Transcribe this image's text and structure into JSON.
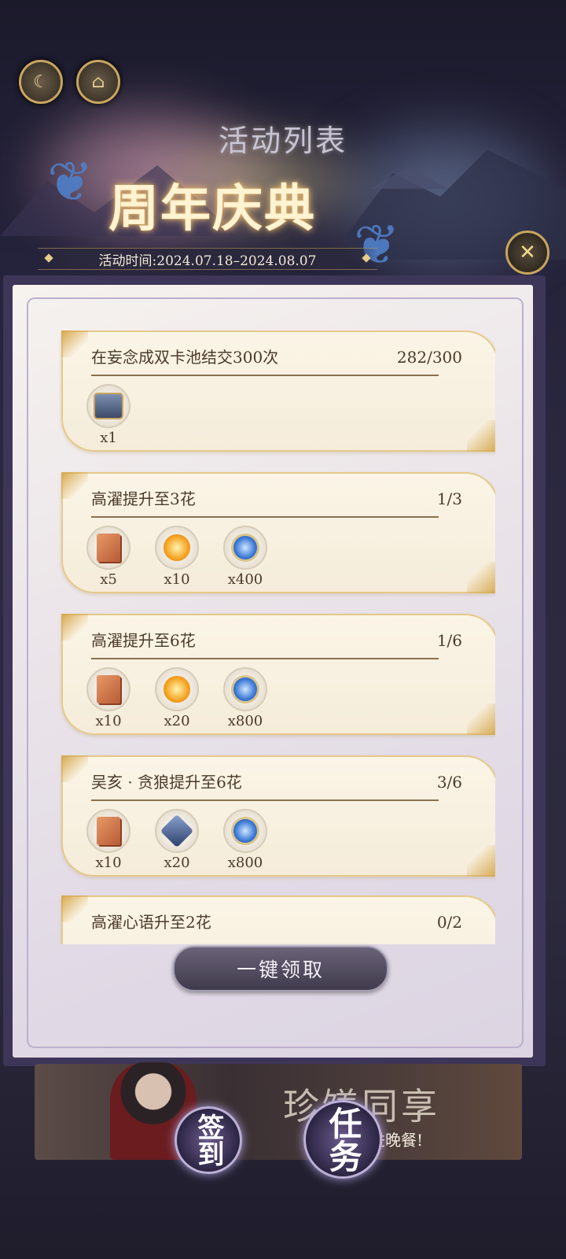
{
  "header": {
    "subtitle": "活动列表",
    "title": "周年庆典",
    "period": "活动时间:2024.07.18–2024.08.07"
  },
  "tasks": [
    {
      "title": "在妄念成双卡池结交300次",
      "progress": "282/300",
      "rewards": [
        {
          "icon": "treasure-chest-icon",
          "qty": "x1"
        }
      ]
    },
    {
      "title": "高濯提升至3花",
      "progress": "1/3",
      "rewards": [
        {
          "icon": "limited-card-icon",
          "qty": "x5"
        },
        {
          "icon": "gold-orb-icon",
          "qty": "x10"
        },
        {
          "icon": "blue-orb-icon",
          "qty": "x400"
        }
      ]
    },
    {
      "title": "高濯提升至6花",
      "progress": "1/6",
      "rewards": [
        {
          "icon": "limited-card-icon",
          "qty": "x10"
        },
        {
          "icon": "gold-orb-icon",
          "qty": "x20"
        },
        {
          "icon": "blue-orb-icon",
          "qty": "x800"
        }
      ]
    },
    {
      "title": "吴亥 · 贪狼提升至6花",
      "progress": "3/6",
      "rewards": [
        {
          "icon": "limited-card-icon",
          "qty": "x10"
        },
        {
          "icon": "dark-crystal-icon",
          "qty": "x20"
        },
        {
          "icon": "blue-orb-icon",
          "qty": "x800"
        }
      ]
    },
    {
      "title": "高濯心语升至2花",
      "progress": "0/2",
      "rewards": []
    }
  ],
  "claim_all_label": "一键领取",
  "banner": {
    "title": "珍馐同享",
    "subtitle": "进晚餐!"
  },
  "nav": {
    "signin_label": "签到",
    "task_label": "任务"
  }
}
